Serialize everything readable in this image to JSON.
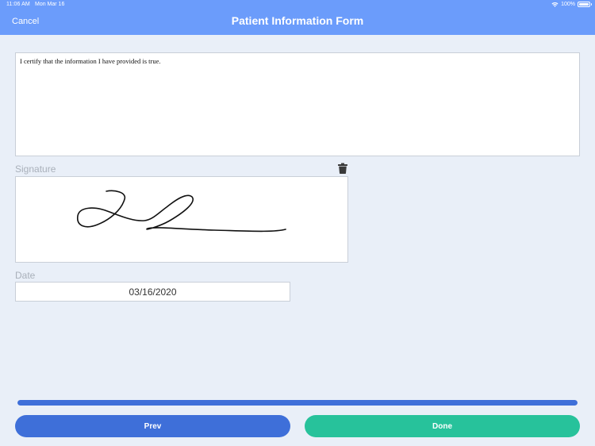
{
  "status_bar": {
    "time": "11:06 AM",
    "date": "Mon Mar 16",
    "battery": "100%",
    "icons": [
      "wifi-icon",
      "battery-icon"
    ]
  },
  "header": {
    "cancel_label": "Cancel",
    "title": "Patient Information Form"
  },
  "certification": {
    "text": "I certify that the information I have provided is true."
  },
  "signature": {
    "label": "Signature",
    "clear_icon": "trash-icon"
  },
  "date": {
    "label": "Date",
    "value": "03/16/2020"
  },
  "progress": {
    "value": 1.0
  },
  "footer": {
    "prev_label": "Prev",
    "done_label": "Done"
  },
  "colors": {
    "header_background": "#6b9cfb",
    "page_background": "#e9eff8",
    "primary_button": "#3e6fd9",
    "done_button": "#27c29b"
  }
}
